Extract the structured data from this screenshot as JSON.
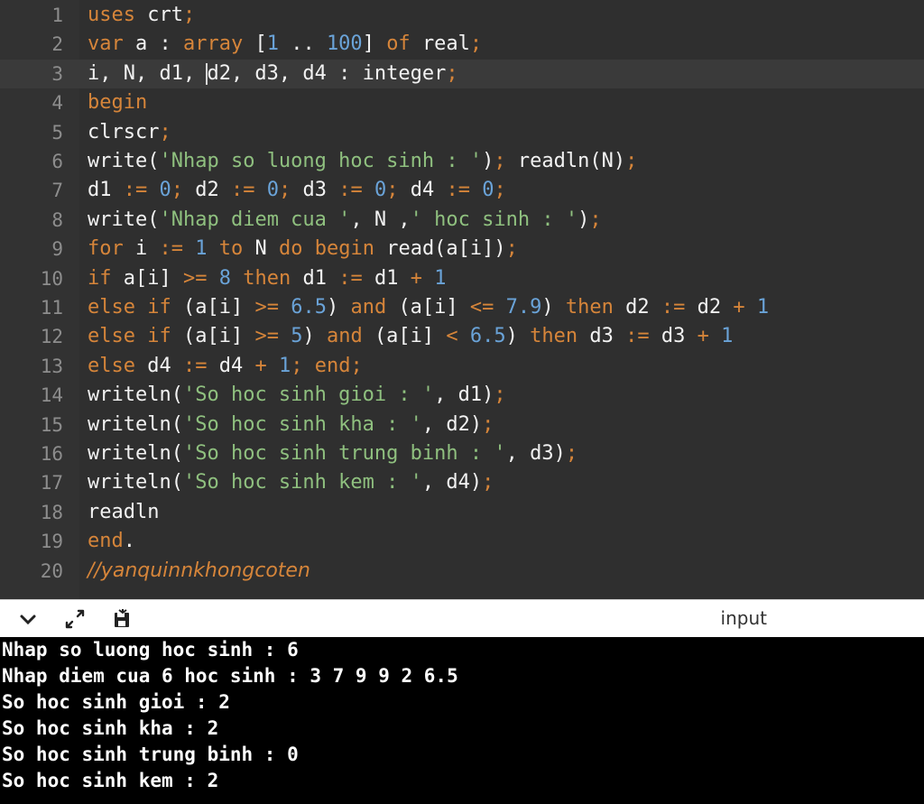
{
  "editor": {
    "lines": [
      {
        "no": "1",
        "segs": [
          [
            "uses ",
            "k"
          ],
          [
            "crt",
            "t"
          ],
          [
            ";",
            "p"
          ]
        ]
      },
      {
        "no": "2",
        "segs": [
          [
            "var ",
            "k"
          ],
          [
            "a : ",
            "t"
          ],
          [
            "array ",
            "k"
          ],
          [
            "[",
            "t"
          ],
          [
            "1",
            "n"
          ],
          [
            " .. ",
            "t"
          ],
          [
            "100",
            "n"
          ],
          [
            "] ",
            "t"
          ],
          [
            "of ",
            "k"
          ],
          [
            "real",
            "t"
          ],
          [
            ";",
            "p"
          ]
        ]
      },
      {
        "no": "3",
        "segs": [
          [
            "i, N, d1, ",
            "t"
          ],
          [
            "|",
            "caret"
          ],
          [
            "d2, d3, d4 : integer",
            "t"
          ],
          [
            ";",
            "p"
          ]
        ]
      },
      {
        "no": "4",
        "segs": [
          [
            "begin",
            "k"
          ]
        ]
      },
      {
        "no": "5",
        "segs": [
          [
            "clrscr",
            "t"
          ],
          [
            ";",
            "p"
          ]
        ]
      },
      {
        "no": "6",
        "segs": [
          [
            "write(",
            "t"
          ],
          [
            "'Nhap so luong hoc sinh : '",
            "s"
          ],
          [
            ")",
            "t"
          ],
          [
            ";",
            "p"
          ],
          [
            " readln(N)",
            "t"
          ],
          [
            ";",
            "p"
          ]
        ]
      },
      {
        "no": "7",
        "segs": [
          [
            "d1 ",
            "t"
          ],
          [
            ":= ",
            "k"
          ],
          [
            "0",
            "n"
          ],
          [
            ";",
            "p"
          ],
          [
            " d2 ",
            "t"
          ],
          [
            ":= ",
            "k"
          ],
          [
            "0",
            "n"
          ],
          [
            ";",
            "p"
          ],
          [
            " d3 ",
            "t"
          ],
          [
            ":= ",
            "k"
          ],
          [
            "0",
            "n"
          ],
          [
            ";",
            "p"
          ],
          [
            " d4 ",
            "t"
          ],
          [
            ":= ",
            "k"
          ],
          [
            "0",
            "n"
          ],
          [
            ";",
            "p"
          ]
        ]
      },
      {
        "no": "8",
        "segs": [
          [
            "write(",
            "t"
          ],
          [
            "'Nhap diem cua '",
            "s"
          ],
          [
            ", N ,",
            "t"
          ],
          [
            "' hoc sinh : '",
            "s"
          ],
          [
            ")",
            "t"
          ],
          [
            ";",
            "p"
          ]
        ]
      },
      {
        "no": "9",
        "segs": [
          [
            "for ",
            "k"
          ],
          [
            "i ",
            "t"
          ],
          [
            ":= ",
            "k"
          ],
          [
            "1 ",
            "n"
          ],
          [
            "to ",
            "k"
          ],
          [
            "N ",
            "t"
          ],
          [
            "do begin ",
            "k"
          ],
          [
            "read(a[i])",
            "t"
          ],
          [
            ";",
            "p"
          ]
        ]
      },
      {
        "no": "10",
        "segs": [
          [
            "if ",
            "k"
          ],
          [
            "a[i] ",
            "t"
          ],
          [
            ">= ",
            "k"
          ],
          [
            "8 ",
            "n"
          ],
          [
            "then ",
            "k"
          ],
          [
            "d1 ",
            "t"
          ],
          [
            ":= ",
            "k"
          ],
          [
            "d1 ",
            "t"
          ],
          [
            "+ ",
            "k"
          ],
          [
            "1",
            "n"
          ]
        ]
      },
      {
        "no": "11",
        "segs": [
          [
            "else if ",
            "k"
          ],
          [
            "(a[i] ",
            "t"
          ],
          [
            ">= ",
            "k"
          ],
          [
            "6.5",
            "n"
          ],
          [
            ") ",
            "t"
          ],
          [
            "and ",
            "k"
          ],
          [
            "(a[i] ",
            "t"
          ],
          [
            "<= ",
            "k"
          ],
          [
            "7.9",
            "n"
          ],
          [
            ") ",
            "t"
          ],
          [
            "then ",
            "k"
          ],
          [
            "d2 ",
            "t"
          ],
          [
            ":= ",
            "k"
          ],
          [
            "d2 ",
            "t"
          ],
          [
            "+ ",
            "k"
          ],
          [
            "1",
            "n"
          ]
        ]
      },
      {
        "no": "12",
        "segs": [
          [
            "else if ",
            "k"
          ],
          [
            "(a[i] ",
            "t"
          ],
          [
            ">= ",
            "k"
          ],
          [
            "5",
            "n"
          ],
          [
            ") ",
            "t"
          ],
          [
            "and ",
            "k"
          ],
          [
            "(a[i] ",
            "t"
          ],
          [
            "< ",
            "k"
          ],
          [
            "6.5",
            "n"
          ],
          [
            ") ",
            "t"
          ],
          [
            "then ",
            "k"
          ],
          [
            "d3 ",
            "t"
          ],
          [
            ":= ",
            "k"
          ],
          [
            "d3 ",
            "t"
          ],
          [
            "+ ",
            "k"
          ],
          [
            "1",
            "n"
          ]
        ]
      },
      {
        "no": "13",
        "segs": [
          [
            "else ",
            "k"
          ],
          [
            "d4 ",
            "t"
          ],
          [
            ":= ",
            "k"
          ],
          [
            "d4 ",
            "t"
          ],
          [
            "+ ",
            "k"
          ],
          [
            "1",
            "n"
          ],
          [
            ";",
            "p"
          ],
          [
            " end",
            "k"
          ],
          [
            ";",
            "p"
          ]
        ]
      },
      {
        "no": "14",
        "segs": [
          [
            "writeln(",
            "t"
          ],
          [
            "'So hoc sinh gioi : '",
            "s"
          ],
          [
            ", d1)",
            "t"
          ],
          [
            ";",
            "p"
          ]
        ]
      },
      {
        "no": "15",
        "segs": [
          [
            "writeln(",
            "t"
          ],
          [
            "'So hoc sinh kha : '",
            "s"
          ],
          [
            ", d2)",
            "t"
          ],
          [
            ";",
            "p"
          ]
        ]
      },
      {
        "no": "16",
        "segs": [
          [
            "writeln(",
            "t"
          ],
          [
            "'So hoc sinh trung binh : '",
            "s"
          ],
          [
            ", d3)",
            "t"
          ],
          [
            ";",
            "p"
          ]
        ]
      },
      {
        "no": "17",
        "segs": [
          [
            "writeln(",
            "t"
          ],
          [
            "'So hoc sinh kem : '",
            "s"
          ],
          [
            ", d4)",
            "t"
          ],
          [
            ";",
            "p"
          ]
        ]
      },
      {
        "no": "18",
        "segs": [
          [
            "readln",
            "t"
          ]
        ]
      },
      {
        "no": "19",
        "segs": [
          [
            "end",
            "k"
          ],
          [
            ".",
            "t"
          ]
        ]
      },
      {
        "no": "20",
        "segs": [
          [
            "//yanquinnkhongcoten",
            "c"
          ]
        ]
      }
    ],
    "active_line": 3
  },
  "toolbar": {
    "input_label": "input",
    "icons": [
      "chevron-down-icon",
      "expand-icon",
      "save-icon"
    ]
  },
  "console": {
    "lines": [
      "Nhap so luong hoc sinh : 6",
      "Nhap diem cua 6 hoc sinh : 3 7 9 9 2 6.5",
      "So hoc sinh gioi : 2",
      "So hoc sinh kha : 2",
      "So hoc sinh trung binh : 0",
      "So hoc sinh kem : 2"
    ]
  }
}
